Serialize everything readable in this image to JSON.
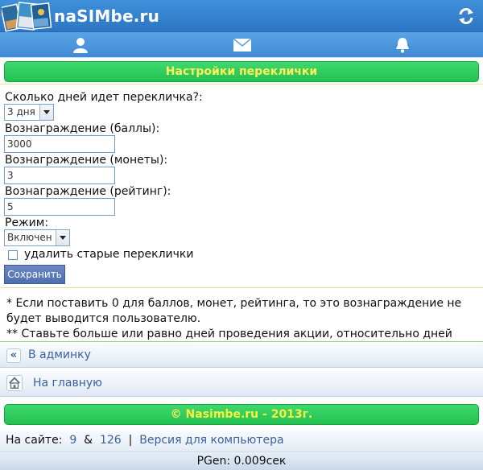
{
  "header": {
    "site_name": "naSIMbe.ru",
    "icons": [
      "logo-collage",
      "refresh-icon"
    ]
  },
  "nav": {
    "icons": [
      "user-icon",
      "mail-icon",
      "bell-icon"
    ]
  },
  "page_title": "Настройки переклички",
  "form": {
    "days_label": "Сколько дней идет перекличка?:",
    "days_value": "3 дня",
    "points_label": "Вознаграждение (баллы):",
    "points_value": "3000",
    "coins_label": "Вознаграждение (монеты):",
    "coins_value": "3",
    "rating_label": "Вознаграждение (рейтинг):",
    "rating_value": "5",
    "mode_label": "Режим:",
    "mode_value": "Включен",
    "delete_old_label": "удалить старые переклички",
    "delete_old_checked": false,
    "save_label": "Сохранить"
  },
  "notes": {
    "line1": "* Если поставить 0 для баллов, монет, рейтинга, то это вознаграждение не будет выводится пользователю.",
    "line2": "** Ставьте больше или равно дней проведения акции, относительно дней переклички."
  },
  "links": {
    "admin_icon": "«",
    "admin": "В админку",
    "home": "На главную"
  },
  "footer": {
    "copyright_symbol": "©",
    "site": "Nasimbe.ru",
    "year": "- 2013г.",
    "online_label": "На сайте:",
    "online_users": "9",
    "amp": "&",
    "online_guests": "126",
    "separator": "|",
    "desktop_link": "Версия для компьютера",
    "pgen": "PGen: 0.009сек"
  },
  "colors": {
    "header_blue": "#2d76c4",
    "green_bar": "#22c250",
    "yellow_text": "#fff05a",
    "link_blue": "#3a5fa3"
  }
}
